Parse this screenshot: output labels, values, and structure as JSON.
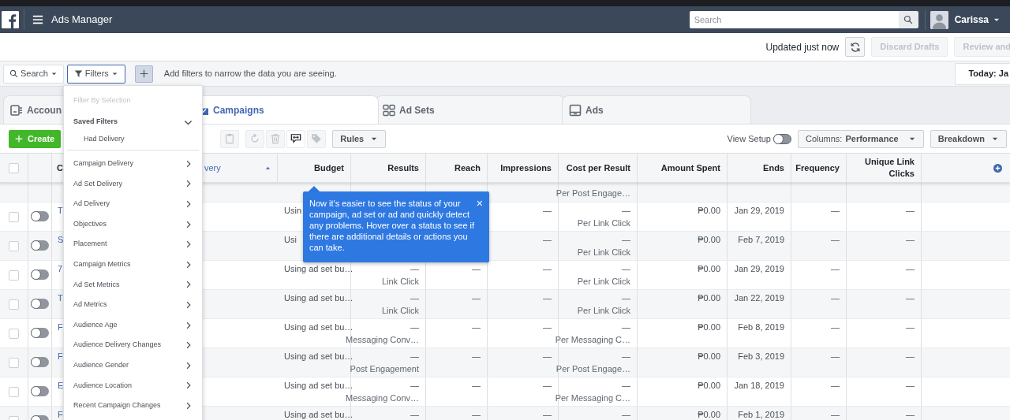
{
  "header": {
    "title": "Ads Manager",
    "search_placeholder": "Search",
    "user": "Carissa"
  },
  "status": {
    "updated": "Updated just now",
    "buttons": [
      {
        "label": "Discard Drafts",
        "disabled": true
      },
      {
        "label": "Review and",
        "disabled": true
      }
    ]
  },
  "filter_bar": {
    "search": "Search",
    "filters": {
      "label": "Filters",
      "selected": true
    },
    "hint": "Add filters to narrow the data you are seeing.",
    "date": "Today: Ja"
  },
  "tabs": [
    {
      "label": "Accoun",
      "kind": "account",
      "selected": false
    },
    {
      "label": "Campaigns",
      "kind": "campaigns",
      "selected": true
    },
    {
      "label": "Ad Sets",
      "kind": "adsets",
      "selected": false
    },
    {
      "label": "Ads",
      "kind": "ads",
      "selected": false
    }
  ],
  "toolbar": {
    "create": "Create",
    "tools": [
      {
        "kind": "clipboard",
        "disabled": true
      },
      {
        "kind": "refresh",
        "disabled": true
      },
      {
        "kind": "trash",
        "disabled": true
      },
      {
        "kind": "compare",
        "disabled": false
      },
      {
        "kind": "tag",
        "disabled": true
      }
    ],
    "rules": "Rules",
    "view_setup": {
      "label": "View Setup",
      "on": false
    },
    "columns_prefix": "Columns:",
    "columns_value": "Performance",
    "breakdown": "Breakdown"
  },
  "table": {
    "select_all": {
      "checked": false
    },
    "columns": [
      {
        "label": "C",
        "kind": "name"
      },
      {
        "label": "very",
        "kind": "delivery",
        "sorted": true
      },
      {
        "label": "Budget",
        "kind": "budget"
      },
      {
        "label": "Results",
        "kind": "num"
      },
      {
        "label": "Reach",
        "kind": "num"
      },
      {
        "label": "Impressions",
        "kind": "num"
      },
      {
        "label": "Cost per Result",
        "kind": "num"
      },
      {
        "label": "Amount Spent",
        "kind": "num"
      },
      {
        "label": "Ends",
        "kind": "num"
      },
      {
        "label": "Frequency",
        "kind": "num"
      },
      {
        "label": "Unique Link Clicks",
        "kind": "num"
      }
    ],
    "rows": [
      {
        "cut": true,
        "cells": [
          null,
          null,
          null,
          null,
          null,
          null,
          {
            "sub": "Per Post Engage…"
          },
          null,
          null,
          null,
          null
        ]
      },
      {
        "cut": false,
        "checked": false,
        "on": false,
        "cells": [
          {
            "main": "T"
          },
          null,
          {
            "main": "Usin"
          },
          null,
          null,
          {
            "main": "—"
          },
          {
            "main": "—",
            "sub": "Per Link Click"
          },
          {
            "main": "₱0.00"
          },
          {
            "main": "Jan 29, 2019"
          },
          {
            "main": "—"
          },
          {
            "main": "—"
          }
        ]
      },
      {
        "cut": false,
        "checked": false,
        "on": false,
        "cells": [
          {
            "main": "S"
          },
          null,
          {
            "main": "Usi"
          },
          null,
          null,
          {
            "main": "—"
          },
          {
            "main": "—",
            "sub": "Per Link Click"
          },
          {
            "main": "₱0.00"
          },
          {
            "main": "Feb 7, 2019"
          },
          {
            "main": "—"
          },
          {
            "main": "—"
          }
        ]
      },
      {
        "cut": false,
        "checked": false,
        "on": false,
        "cells": [
          {
            "main": "7"
          },
          null,
          {
            "main": "Using ad set bu…"
          },
          {
            "main": "—",
            "sub": "Link Click"
          },
          {
            "main": "—"
          },
          {
            "main": "—"
          },
          {
            "main": "—",
            "sub": "Per Link Click"
          },
          {
            "main": "₱0.00"
          },
          {
            "main": "Jan 29, 2019"
          },
          {
            "main": "—"
          },
          {
            "main": "—"
          }
        ]
      },
      {
        "cut": false,
        "checked": false,
        "on": false,
        "cells": [
          {
            "main": "T"
          },
          null,
          {
            "main": "Using ad set bu…"
          },
          {
            "main": "—",
            "sub": "Link Click"
          },
          {
            "main": "—"
          },
          {
            "main": "—"
          },
          {
            "main": "—",
            "sub": "Per Link Click"
          },
          {
            "main": "₱0.00"
          },
          {
            "main": "Jan 22, 2019"
          },
          {
            "main": "—"
          },
          {
            "main": "—"
          }
        ]
      },
      {
        "cut": false,
        "checked": false,
        "on": false,
        "cells": [
          {
            "main": "F"
          },
          null,
          {
            "main": "Using ad set bu…"
          },
          {
            "main": "—",
            "sub": "Messaging Conv…"
          },
          {
            "main": "—"
          },
          {
            "main": "—"
          },
          {
            "main": "—",
            "sub": "Per Messaging C…"
          },
          {
            "main": "₱0.00"
          },
          {
            "main": "Feb 8, 2019"
          },
          {
            "main": "—"
          },
          {
            "main": "—"
          }
        ]
      },
      {
        "cut": false,
        "checked": false,
        "on": false,
        "cells": [
          {
            "main": "F"
          },
          null,
          {
            "main": "Using ad set bu…"
          },
          {
            "main": "—",
            "sub": "Post Engagement"
          },
          {
            "main": "—"
          },
          {
            "main": "—"
          },
          {
            "main": "—",
            "sub": "Per Post Engage…"
          },
          {
            "main": "₱0.00"
          },
          {
            "main": "Feb 3, 2019"
          },
          {
            "main": "—"
          },
          {
            "main": "—"
          }
        ]
      },
      {
        "cut": false,
        "checked": false,
        "on": false,
        "cells": [
          {
            "main": "E"
          },
          null,
          {
            "main": "Using ad set bu…"
          },
          {
            "main": "—",
            "sub": "Messaging Conv…"
          },
          {
            "main": "—"
          },
          {
            "main": "—"
          },
          {
            "main": "—",
            "sub": "Per Messaging C…"
          },
          {
            "main": "₱0.00"
          },
          {
            "main": "Jan 18, 2019"
          },
          {
            "main": "—"
          },
          {
            "main": "—"
          }
        ]
      },
      {
        "cut": false,
        "checked": false,
        "on": false,
        "cells": [
          {
            "main": "F"
          },
          null,
          {
            "main": "Using ad set bu…"
          },
          {
            "main": "—"
          },
          {
            "main": "—"
          },
          {
            "main": "—"
          },
          {
            "main": "—"
          },
          {
            "main": "₱0.00"
          },
          {
            "main": "Feb 1, 2019"
          },
          {
            "main": "—"
          },
          {
            "main": "—"
          }
        ]
      }
    ]
  },
  "filter_menu": {
    "heading": {
      "label": "Filter By Selection",
      "disabled": true
    },
    "saved": {
      "label": "Saved Filters",
      "expanded": true,
      "items": [
        "Had Delivery"
      ]
    },
    "items": [
      "Campaign Delivery",
      "Ad Set Delivery",
      "Ad Delivery",
      "Objectives",
      "Placement",
      "Campaign Metrics",
      "Ad Set Metrics",
      "Ad Metrics",
      "Audience Age",
      "Audience Delivery Changes",
      "Audience Gender",
      "Audience Location",
      "Recent Campaign Changes"
    ]
  },
  "tooltip": {
    "text": "Now it's easier to see the status of your campaign, ad set or ad and quickly detect any problems. Hover over a status to see if there are additional details or actions you can take.",
    "close": "×"
  }
}
